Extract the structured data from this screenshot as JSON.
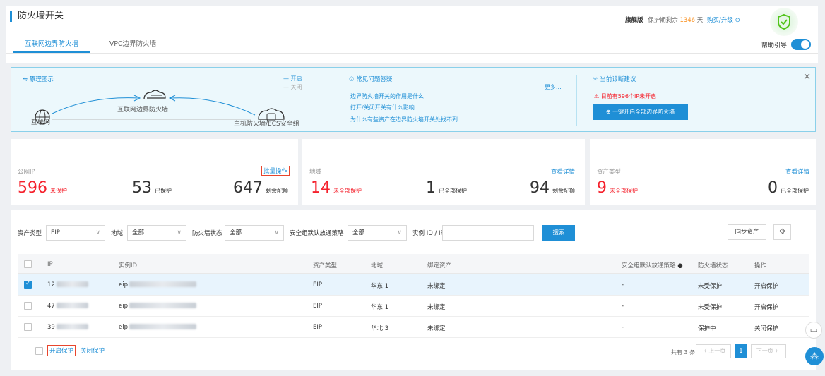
{
  "header": {
    "title": "防火墙开关",
    "edition": "旗舰版",
    "protect_prefix": "保护期剩余",
    "protect_days": "1346",
    "protect_unit": "天",
    "upgrade": "购买/升级"
  },
  "tabs": [
    {
      "label": "互联网边界防火墙"
    },
    {
      "label": "VPC边界防火墙"
    }
  ],
  "help": {
    "label": "帮助引导"
  },
  "diagram": {
    "title": "原理图示",
    "legend_on": "开启",
    "legend_off": "关闭",
    "internet": "互联网",
    "fw": "互联网边界防火墙",
    "host": "主机防火墙/ECS安全组"
  },
  "faq": {
    "title": "常见问题答疑",
    "more": "更多...",
    "items": [
      "边界防火墙开关的作用是什么",
      "打开/关闭开关有什么影响",
      "为什么有些资产在边界防火墙开关处找不到"
    ]
  },
  "advice": {
    "title": "当前诊断建议",
    "warning": "目前有596个IP未开启",
    "button": "一键开启全部边界防火墙"
  },
  "cards": {
    "ip": {
      "label": "公网IP",
      "action": "批量操作",
      "n1": "596",
      "l1": "未保护",
      "n2": "53",
      "l2": "已保护",
      "n3": "647",
      "l3": "剩余配额"
    },
    "region": {
      "label": "地域",
      "action": "查看详情",
      "n1": "14",
      "l1": "未全部保护",
      "n2": "1",
      "l2": "已全部保护",
      "n3": "94",
      "l3": "剩余配额"
    },
    "type": {
      "label": "资产类型",
      "action": "查看详情",
      "n1": "9",
      "l1": "未全部保护",
      "n2": "0",
      "l2": "已全部保护"
    }
  },
  "filters": {
    "asset_type_label": "资产类型",
    "asset_type": "EIP",
    "region_label": "地域",
    "region": "全部",
    "fw_status_label": "防火墙状态",
    "fw_status": "全部",
    "sg_label": "安全组默认放通策略",
    "sg": "全部",
    "instance_label": "实例 ID / IP",
    "instance_value": "",
    "search": "搜索",
    "sync": "同步资产"
  },
  "table": {
    "headers": {
      "ip": "IP",
      "instance": "实例ID",
      "type": "资产类型",
      "region": "地域",
      "bind": "绑定资产",
      "sg": "安全组默认放通策略",
      "status": "防火墙状态",
      "op": "操作"
    },
    "rows": [
      {
        "ip": "12",
        "instance": "eip",
        "type": "EIP",
        "region": "华东 1",
        "bind": "未绑定",
        "sg": "-",
        "status": "未受保护",
        "op": "开启保护",
        "checked": true
      },
      {
        "ip": "47",
        "instance": "eip",
        "type": "EIP",
        "region": "华东 1",
        "bind": "未绑定",
        "sg": "-",
        "status": "未受保护",
        "op": "开启保护",
        "checked": false
      },
      {
        "ip": "39",
        "instance": "eip",
        "type": "EIP",
        "region": "华北 3",
        "bind": "未绑定",
        "sg": "-",
        "status": "保护中",
        "op": "关闭保护",
        "checked": false
      }
    ]
  },
  "footer": {
    "enable": "开启保护",
    "disable": "关闭保护",
    "total": "共有 3 条",
    "prev": "上一页",
    "page": "1",
    "next": "下一页"
  },
  "colors": {
    "accent": "#1f8fd6",
    "danger": "#f5222d",
    "orange": "#fa8c16",
    "green": "#52c41a"
  },
  "icons": [
    "shield-check-icon",
    "close-icon",
    "cloud-icon",
    "globe-icon",
    "server-cloud-icon",
    "question-icon",
    "bulb-icon",
    "warning-icon",
    "gear-icon",
    "chat-icon",
    "apps-icon"
  ]
}
